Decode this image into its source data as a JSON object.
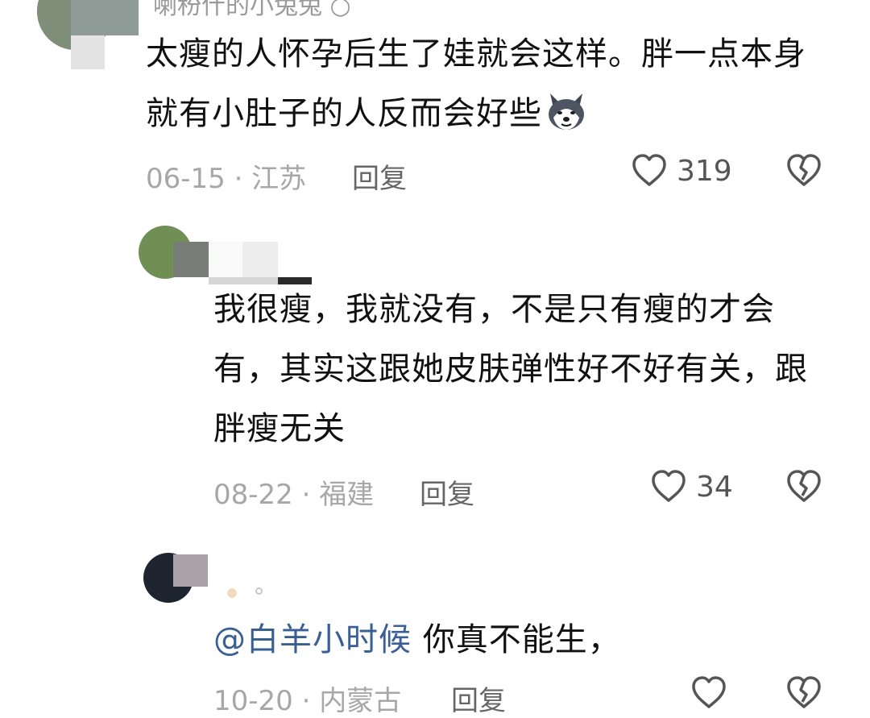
{
  "comments": [
    {
      "username": "喇秎什的小兔兔 ○",
      "text": "太瘦的人怀孕后生了娃就会这样。胖一点本身就有小肚子的人反而会好些",
      "date": "06-15",
      "location": "江苏",
      "reply_label": "回复",
      "likes": "319"
    },
    {
      "text": "我很瘦，我就没有，不是只有瘦的才会有，其实这跟她皮肤弹性好不好有关，跟胖瘦无关",
      "date": "08-22",
      "location": "福建",
      "reply_label": "回复",
      "likes": "34"
    },
    {
      "mention": "@白羊小时候",
      "text": "你真不能生，",
      "date": "10-20",
      "location": "内蒙古",
      "reply_label": "回复",
      "likes": ""
    }
  ],
  "meta_separator": "·",
  "colors": {
    "mention": "#3a5f95",
    "meta": "#a7a7a7",
    "icon": "#555555"
  },
  "icons": {
    "like": "heart-icon",
    "dislike": "broken-heart-icon",
    "emoji": "husky-dog-emoji"
  }
}
